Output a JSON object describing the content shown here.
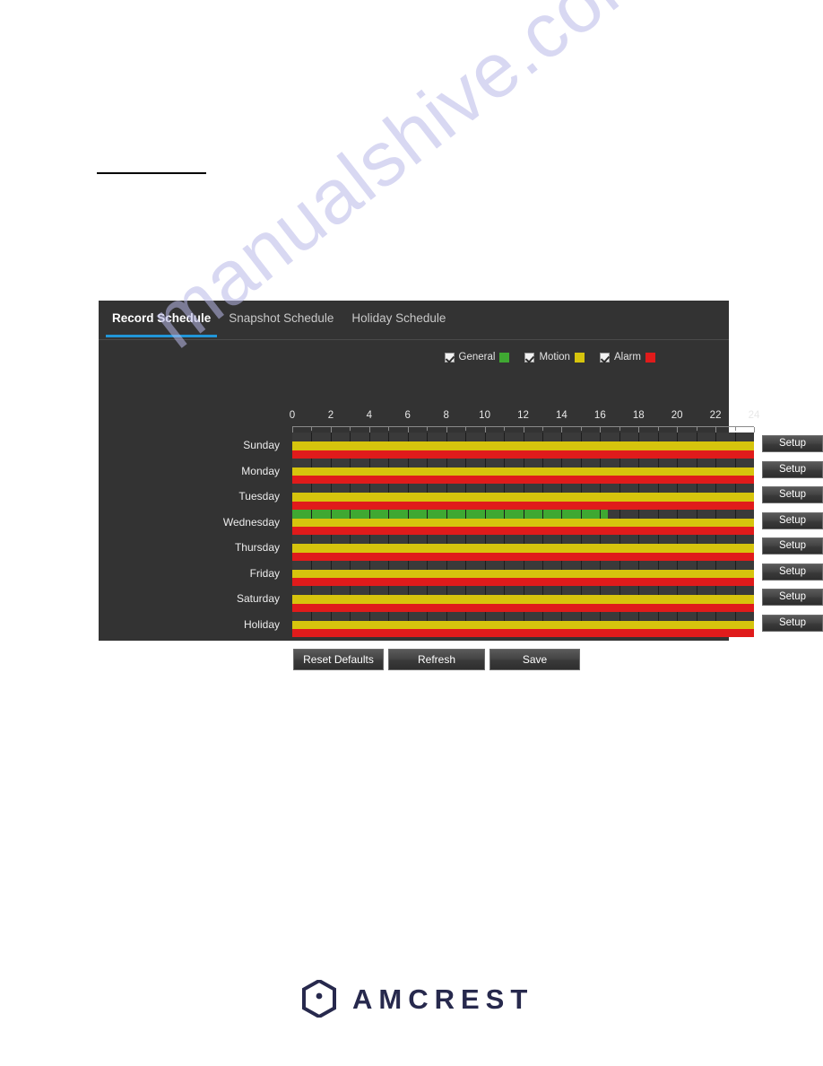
{
  "watermark": {
    "text": "manualshive.com"
  },
  "panel": {
    "tabs": [
      {
        "label": "Record Schedule",
        "active": true
      },
      {
        "label": "Snapshot Schedule",
        "active": false
      },
      {
        "label": "Holiday Schedule",
        "active": false
      }
    ],
    "legend": [
      {
        "label": "General",
        "color": "#3fa832",
        "checked": true
      },
      {
        "label": "Motion",
        "color": "#d6c40d",
        "checked": true
      },
      {
        "label": "Alarm",
        "color": "#e01b1b",
        "checked": true
      }
    ],
    "axis": {
      "min": 0,
      "max": 24,
      "labels": [
        "0",
        "2",
        "4",
        "6",
        "8",
        "10",
        "12",
        "14",
        "16",
        "18",
        "20",
        "22",
        "24"
      ]
    },
    "setup_label": "Setup",
    "rows": [
      {
        "day": "Sunday",
        "general": [],
        "motion": [
          [
            0,
            24
          ]
        ],
        "alarm": [
          [
            0,
            24
          ]
        ]
      },
      {
        "day": "Monday",
        "general": [],
        "motion": [
          [
            0,
            24
          ]
        ],
        "alarm": [
          [
            0,
            24
          ]
        ]
      },
      {
        "day": "Tuesday",
        "general": [],
        "motion": [
          [
            0,
            24
          ]
        ],
        "alarm": [
          [
            0,
            24
          ]
        ]
      },
      {
        "day": "Wednesday",
        "general": [
          [
            0,
            16.4
          ]
        ],
        "motion": [
          [
            0,
            24
          ]
        ],
        "alarm": [
          [
            0,
            24
          ]
        ]
      },
      {
        "day": "Thursday",
        "general": [],
        "motion": [
          [
            0,
            24
          ]
        ],
        "alarm": [
          [
            0,
            24
          ]
        ]
      },
      {
        "day": "Friday",
        "general": [],
        "motion": [
          [
            0,
            24
          ]
        ],
        "alarm": [
          [
            0,
            24
          ]
        ]
      },
      {
        "day": "Saturday",
        "general": [],
        "motion": [
          [
            0,
            24
          ]
        ],
        "alarm": [
          [
            0,
            24
          ]
        ]
      },
      {
        "day": "Holiday",
        "general": [],
        "motion": [
          [
            0,
            24
          ]
        ],
        "alarm": [
          [
            0,
            24
          ]
        ]
      }
    ],
    "actions": [
      {
        "label": "Reset Defaults",
        "cls": "btn-reset"
      },
      {
        "label": "Refresh",
        "cls": "btn-refresh"
      },
      {
        "label": "Save",
        "cls": "btn-save"
      }
    ]
  },
  "footer": {
    "brand": "AMCREST"
  }
}
